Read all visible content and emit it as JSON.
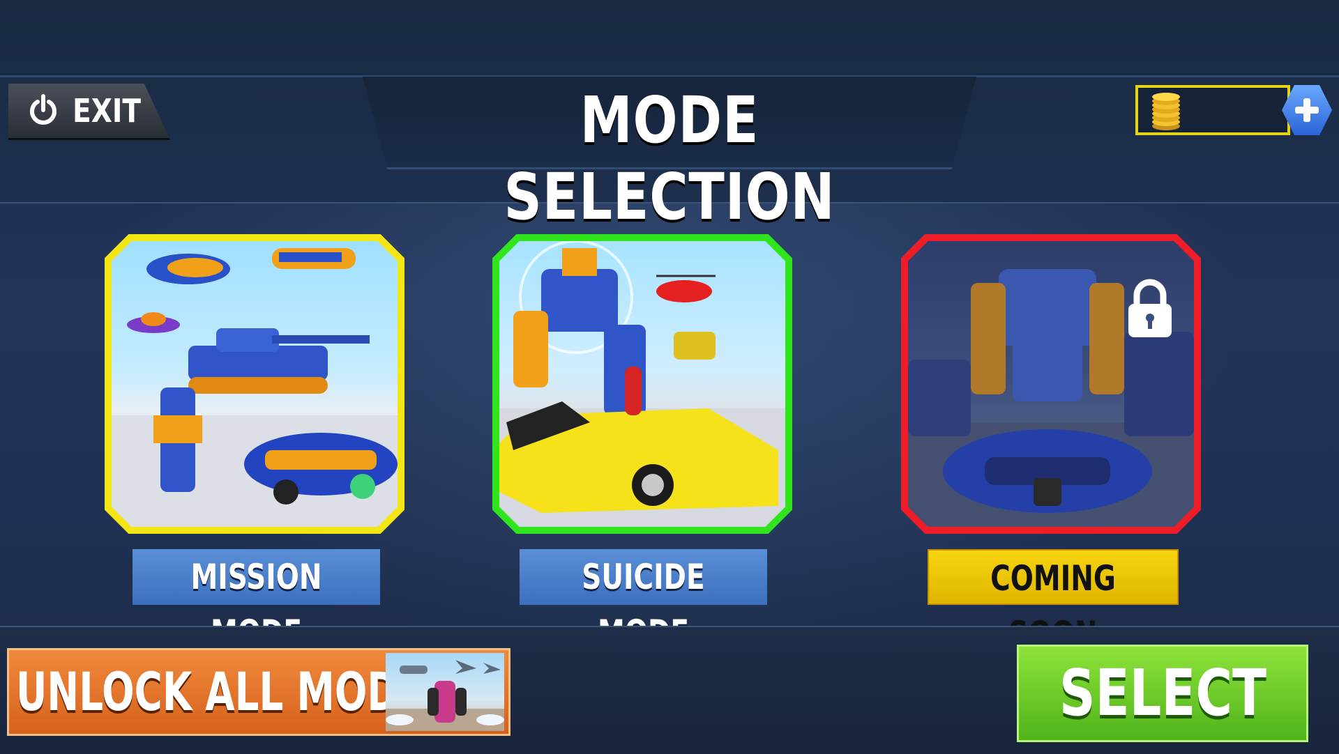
{
  "header": {
    "title": "MODE SELECTION",
    "exit_label": "EXIT",
    "coins": {
      "value": "",
      "icon": "gold-coins-icon",
      "add_icon": "plus-icon"
    }
  },
  "modes": [
    {
      "label": "MISSION MODE",
      "frame_color": "#f3e614",
      "state": "available"
    },
    {
      "label": "SUICIDE MODE",
      "frame_color": "#30e51b",
      "state": "selected"
    },
    {
      "label": "COMING SOON",
      "frame_color": "#ef1d27",
      "state": "locked",
      "icon": "lock-icon"
    }
  ],
  "footer": {
    "unlock_label": "UNLOCK ALL MODES",
    "select_label": "SELECT"
  }
}
